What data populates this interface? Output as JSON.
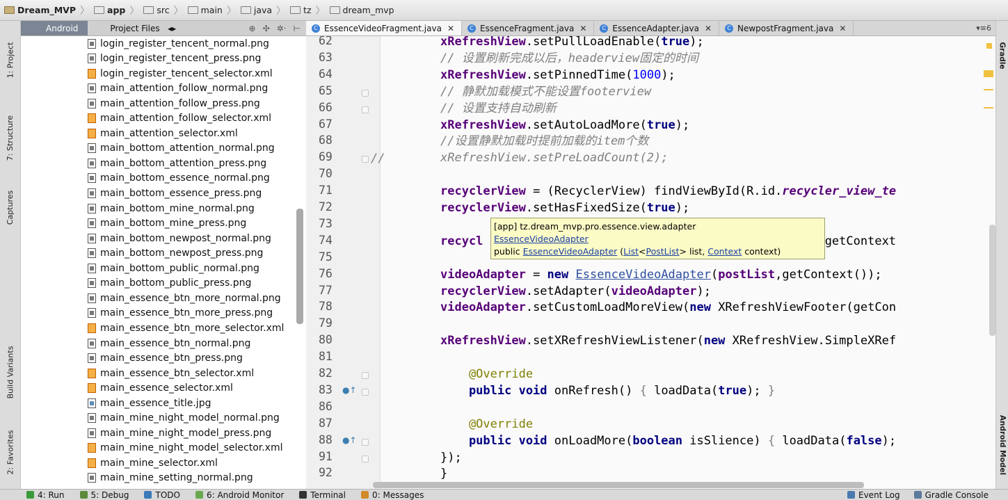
{
  "breadcrumb": [
    {
      "label": "Dream_MVP",
      "bold": true
    },
    {
      "label": "app",
      "bold": true
    },
    {
      "label": "src"
    },
    {
      "label": "main"
    },
    {
      "label": "java"
    },
    {
      "label": "tz"
    },
    {
      "label": "dream_mvp"
    }
  ],
  "left_tools": [
    "1: Project",
    "7: Structure",
    "Captures",
    "Build Variants",
    "2: Favorites"
  ],
  "right_tools": [
    "Gradle",
    "Android Model"
  ],
  "project_panel": {
    "tab_android": "Android",
    "tab_files": "Project Files",
    "files": [
      {
        "name": "login_register_tencent_normal.png",
        "type": "png"
      },
      {
        "name": "login_register_tencent_press.png",
        "type": "png"
      },
      {
        "name": "login_register_tencent_selector.xml",
        "type": "xml"
      },
      {
        "name": "main_attention_follow_normal.png",
        "type": "png"
      },
      {
        "name": "main_attention_follow_press.png",
        "type": "png"
      },
      {
        "name": "main_attention_follow_selector.xml",
        "type": "xml"
      },
      {
        "name": "main_attention_selector.xml",
        "type": "xml"
      },
      {
        "name": "main_bottom_attention_normal.png",
        "type": "png"
      },
      {
        "name": "main_bottom_attention_press.png",
        "type": "png"
      },
      {
        "name": "main_bottom_essence_normal.png",
        "type": "png"
      },
      {
        "name": "main_bottom_essence_press.png",
        "type": "png"
      },
      {
        "name": "main_bottom_mine_normal.png",
        "type": "png"
      },
      {
        "name": "main_bottom_mine_press.png",
        "type": "png"
      },
      {
        "name": "main_bottom_newpost_normal.png",
        "type": "png"
      },
      {
        "name": "main_bottom_newpost_press.png",
        "type": "png"
      },
      {
        "name": "main_bottom_public_normal.png",
        "type": "png"
      },
      {
        "name": "main_bottom_public_press.png",
        "type": "png"
      },
      {
        "name": "main_essence_btn_more_normal.png",
        "type": "png"
      },
      {
        "name": "main_essence_btn_more_press.png",
        "type": "png"
      },
      {
        "name": "main_essence_btn_more_selector.xml",
        "type": "xml"
      },
      {
        "name": "main_essence_btn_normal.png",
        "type": "png"
      },
      {
        "name": "main_essence_btn_press.png",
        "type": "png"
      },
      {
        "name": "main_essence_btn_selector.xml",
        "type": "xml"
      },
      {
        "name": "main_essence_selector.xml",
        "type": "xml"
      },
      {
        "name": "main_essence_title.jpg",
        "type": "jpg"
      },
      {
        "name": "main_mine_night_model_normal.png",
        "type": "png"
      },
      {
        "name": "main_mine_night_model_press.png",
        "type": "png"
      },
      {
        "name": "main_mine_night_model_selector.xml",
        "type": "xml"
      },
      {
        "name": "main_mine_selector.xml",
        "type": "xml"
      },
      {
        "name": "main_mine_setting_normal.png",
        "type": "png"
      }
    ]
  },
  "editor_tabs": [
    {
      "label": "EssenceVideoFragment.java",
      "active": true
    },
    {
      "label": "EssenceFragment.java"
    },
    {
      "label": "EssenceAdapter.java"
    },
    {
      "label": "NewpostFragment.java"
    }
  ],
  "tabs_overflow": "▾≡6",
  "line_numbers": [
    "62",
    "63",
    "64",
    "65",
    "66",
    "67",
    "68",
    "69",
    "70",
    "71",
    "72",
    "73",
    "74",
    "75",
    "76",
    "77",
    "78",
    "79",
    "80",
    "81",
    "82",
    "83",
    "86",
    "87",
    "88",
    "91",
    "92"
  ],
  "code_lines": [
    [
      [
        "fld",
        "xRefreshView"
      ],
      [
        "",
        "."
      ],
      [
        "",
        "setPullLoadEnable"
      ],
      [
        "",
        "("
      ],
      [
        "kw",
        "true"
      ],
      [
        "",
        ");"
      ]
    ],
    [
      [
        "cmt",
        "// 设置刷新完成以后，headerview固定的时间"
      ]
    ],
    [
      [
        "fld",
        "xRefreshView"
      ],
      [
        "",
        ".setPinnedTime("
      ],
      [
        "num",
        "1000"
      ],
      [
        "",
        ");"
      ]
    ],
    [
      [
        "cmt",
        "// 静默加载模式不能设置footerview"
      ]
    ],
    [
      [
        "cmt",
        "// 设置支持自动刷新"
      ]
    ],
    [
      [
        "fld",
        "xRefreshView"
      ],
      [
        "",
        ".setAutoLoadMore("
      ],
      [
        "kw",
        "true"
      ],
      [
        "",
        ");"
      ]
    ],
    [
      [
        "cmt",
        "//设置静默加载时提前加载的item个数"
      ]
    ],
    [
      [
        "cmt",
        "xRefreshView.setPreLoadCount(2);"
      ]
    ],
    [],
    [
      [
        "fld",
        "recyclerView"
      ],
      [
        "",
        " = (RecyclerView) findViewById(R.id."
      ],
      [
        "stat",
        "recycler_view_te"
      ]
    ],
    [
      [
        "fld",
        "recyclerView"
      ],
      [
        "",
        ".setHasFixedSize("
      ],
      [
        "kw",
        "true"
      ],
      [
        "",
        ");"
      ]
    ],
    [],
    [
      [
        "fld",
        "recycl"
      ],
      [
        "",
        "                                      utManager(getContext"
      ]
    ],
    [],
    [
      [
        "fld",
        "videoAdapter"
      ],
      [
        "",
        " = "
      ],
      [
        "kw",
        "new "
      ],
      [
        "link",
        "EssenceVideoAdapter"
      ],
      [
        "",
        "("
      ],
      [
        "fld",
        "postList"
      ],
      [
        "",
        ",getContext());"
      ]
    ],
    [
      [
        "fld",
        "recyclerView"
      ],
      [
        "",
        ".setAdapter("
      ],
      [
        "fld",
        "videoAdapter"
      ],
      [
        "",
        ");"
      ]
    ],
    [
      [
        "fld",
        "videoAdapter"
      ],
      [
        "",
        ".setCustomLoadMoreView("
      ],
      [
        "kw",
        "new "
      ],
      [
        "",
        "XRefreshViewFooter(getCon"
      ]
    ],
    [],
    [
      [
        "fld",
        "xRefreshView"
      ],
      [
        "",
        ".setXRefreshViewListener("
      ],
      [
        "kw",
        "new "
      ],
      [
        "",
        "XRefreshView.SimpleXRef"
      ]
    ],
    [],
    [
      [
        "ann",
        "    @Override"
      ]
    ],
    [
      [
        "kw",
        "    public void "
      ],
      [
        "",
        "onRefresh() "
      ],
      [
        "bull",
        "{ "
      ],
      [
        "",
        "loadData("
      ],
      [
        "kw",
        "true"
      ],
      [
        "",
        ");"
      ],
      [
        "bull",
        " }"
      ]
    ],
    [],
    [
      [
        "ann",
        "    @Override"
      ]
    ],
    [
      [
        "kw",
        "    public void "
      ],
      [
        "",
        "onLoadMore("
      ],
      [
        "kw",
        "boolean "
      ],
      [
        "",
        "isSlience) "
      ],
      [
        "bull",
        "{ "
      ],
      [
        "",
        "loadData("
      ],
      [
        "kw",
        "false"
      ],
      [
        "",
        ");"
      ]
    ],
    [
      [
        "",
        "});"
      ]
    ],
    [
      [
        "",
        "}"
      ]
    ]
  ],
  "line69_prefix": "//",
  "tooltip": {
    "line1": "[app] tz.dream_mvp.pro.essence.view.adapter",
    "class_link": "EssenceVideoAdapter",
    "sig_prefix": "public ",
    "sig_name": "EssenceVideoAdapter",
    "sig_open": " (",
    "sig_list": "List",
    "sig_lt": "<",
    "sig_postlist": "PostList",
    "sig_mid": "> list, ",
    "sig_context": "Context",
    "sig_end": " context)"
  },
  "bottom_tools": [
    {
      "label": "4: Run",
      "color": "#3a9a3a"
    },
    {
      "label": "5: Debug",
      "color": "#5c8a3a"
    },
    {
      "label": "TODO",
      "color": "#3a7ab8"
    },
    {
      "label": "6: Android Monitor",
      "color": "#6aa84f"
    },
    {
      "label": "Terminal",
      "color": "#333333"
    },
    {
      "label": "0: Messages",
      "color": "#d08a2a"
    }
  ],
  "bottom_right": [
    "Event Log",
    "Gradle Console"
  ]
}
